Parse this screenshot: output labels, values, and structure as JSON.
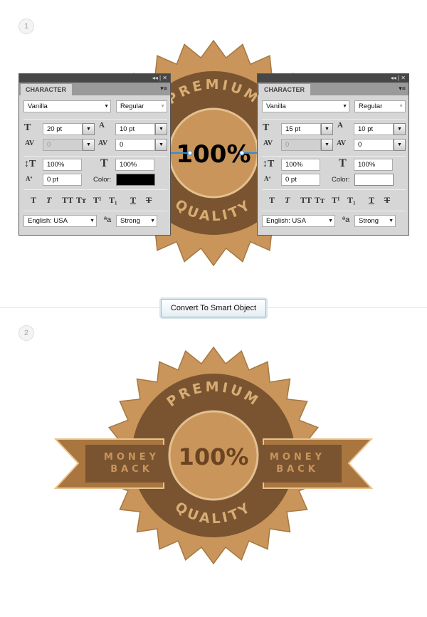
{
  "steps": [
    "1",
    "2"
  ],
  "badge": {
    "top_text": "PREMIUM",
    "center_text": "100%",
    "bottom_text": "QUALITY",
    "ribbon_left": [
      "MONEY",
      "BACK"
    ],
    "ribbon_right": [
      "MONEY",
      "BACK"
    ],
    "colors": {
      "light": "#c9955a",
      "dark": "#7a5430",
      "ribbon": "#a9763f"
    }
  },
  "panels": [
    {
      "header_icons": "◂◂ | ✕",
      "tab": "CHARACTER",
      "menu_icon": "▾≡",
      "font": "Vanilla",
      "style": "Regular",
      "size": "20 pt",
      "leading": "10 pt",
      "kerning": "0",
      "tracking": "0",
      "vscale": "100%",
      "hscale": "100%",
      "baseline": "0 pt",
      "color_label": "Color:",
      "color": "#000000",
      "styles": [
        "T",
        "T",
        "TT",
        "Tт",
        "T¹",
        "T₁",
        "T",
        "T"
      ],
      "language": "English: USA",
      "aa_icon": "ªa",
      "antialias": "Strong"
    },
    {
      "header_icons": "◂◂ | ✕",
      "tab": "CHARACTER",
      "menu_icon": "▾≡",
      "font": "Vanilla",
      "style": "Regular",
      "size": "15 pt",
      "leading": "10 pt",
      "kerning": "0",
      "tracking": "0",
      "vscale": "100%",
      "hscale": "100%",
      "baseline": "0 pt",
      "color_label": "Color:",
      "color": "#ffffff",
      "styles": [
        "T",
        "T",
        "TT",
        "Tт",
        "T¹",
        "T₁",
        "T",
        "T"
      ],
      "language": "English: USA",
      "aa_icon": "ªa",
      "antialias": "Strong"
    }
  ],
  "convert_button": "Convert To Smart Object"
}
